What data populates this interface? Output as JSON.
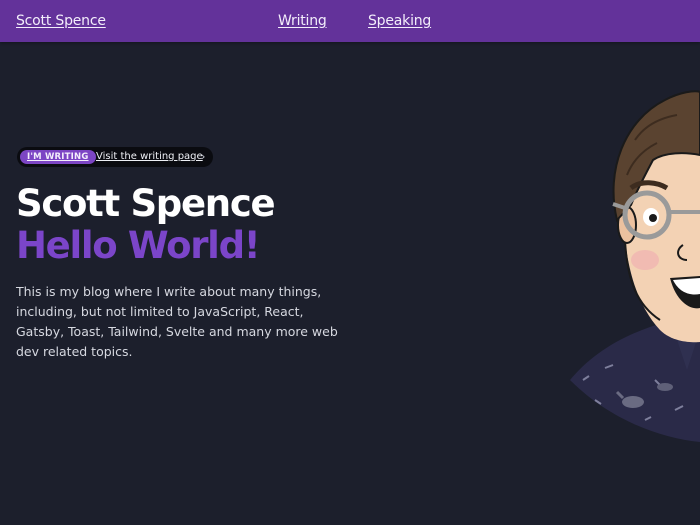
{
  "nav": {
    "brand": "Scott Spence",
    "links": [
      "Writing",
      "Speaking"
    ]
  },
  "hero": {
    "badge": "I'M WRITING",
    "badge_link": "Visit the writing page",
    "name": "Scott Spence",
    "greeting": "Hello World!",
    "description": "This is my blog where I write about many things, including, but not limited to JavaScript, React, Gatsby, Toast, Tailwind, Svelte and many more web dev related topics."
  },
  "icons": {
    "pill_chevron": "chevron-right-icon"
  },
  "colors": {
    "nav_bg": "#63329a",
    "page_bg": "#1c1f2c",
    "accent": "#7b45c9",
    "text": "#ffffff"
  }
}
